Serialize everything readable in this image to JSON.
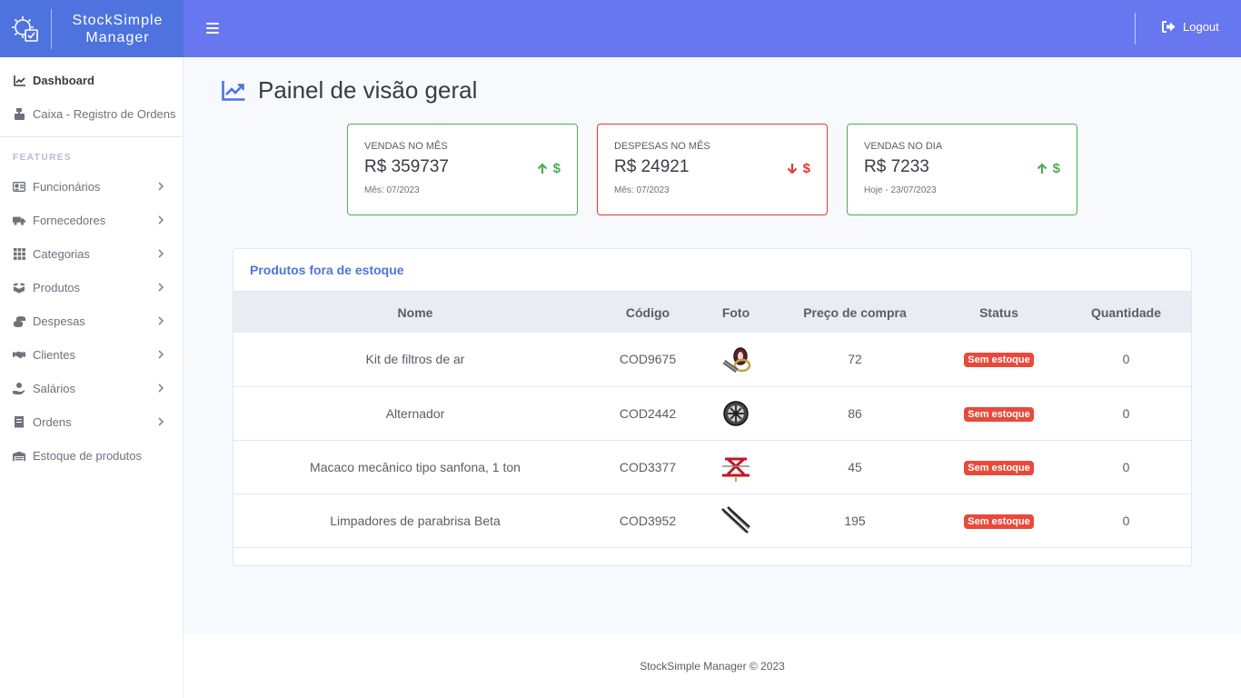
{
  "brand": {
    "line1": "StockSimple",
    "line2": "Manager"
  },
  "topbar": {
    "logout_label": "Logout"
  },
  "sidebar": {
    "items": [
      {
        "label": "Dashboard"
      },
      {
        "label": "Caixa - Registro de Ordens"
      }
    ],
    "heading": "FEATURES",
    "features": [
      {
        "label": "Funcionários"
      },
      {
        "label": "Fornecedores"
      },
      {
        "label": "Categorias"
      },
      {
        "label": "Produtos"
      },
      {
        "label": "Despesas"
      },
      {
        "label": "Clientes"
      },
      {
        "label": "Salários"
      },
      {
        "label": "Ordens"
      },
      {
        "label": "Estoque de produtos"
      }
    ]
  },
  "page": {
    "title": "Painel de visão geral"
  },
  "cards": [
    {
      "label": "VENDAS NO MÊS",
      "value": "R$ 359737",
      "sub": "Mês: 07/2023",
      "trend": "up",
      "color": "#4caf50"
    },
    {
      "label": "DESPESAS NO MÊS",
      "value": "R$ 24921",
      "sub": "Mês: 07/2023",
      "trend": "down",
      "color": "#e53935"
    },
    {
      "label": "VENDAS NO DIA",
      "value": "R$ 7233",
      "sub": "Hoje - 23/07/2023",
      "trend": "up",
      "color": "#4caf50"
    }
  ],
  "table": {
    "title": "Produtos fora de estoque",
    "columns": [
      "Nome",
      "Código",
      "Foto",
      "Preço de compra",
      "Status",
      "Quantidade"
    ],
    "rows": [
      {
        "nome": "Kit de filtros de ar",
        "codigo": "COD9675",
        "foto": "air-filter-kit",
        "preco": "72",
        "status": "Sem estoque",
        "quantidade": "0"
      },
      {
        "nome": "Alternador",
        "codigo": "COD2442",
        "foto": "alternator",
        "preco": "86",
        "status": "Sem estoque",
        "quantidade": "0"
      },
      {
        "nome": "Macaco mecânico tipo sanfona, 1 ton",
        "codigo": "COD3377",
        "foto": "scissor-jack",
        "preco": "45",
        "status": "Sem estoque",
        "quantidade": "0"
      },
      {
        "nome": "Limpadores de parabrisa Beta",
        "codigo": "COD3952",
        "foto": "wiper-blades",
        "preco": "195",
        "status": "Sem estoque",
        "quantidade": "0"
      }
    ]
  },
  "footer": {
    "text": "StockSimple Manager © 2023"
  }
}
